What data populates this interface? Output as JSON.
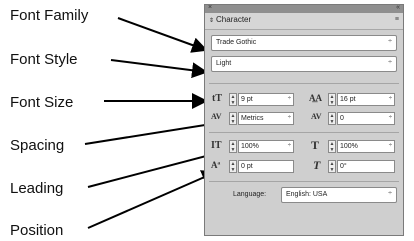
{
  "labels": {
    "font_family": "Font Family",
    "font_style": "Font Style",
    "font_size": "Font Size",
    "spacing": "Spacing",
    "leading": "Leading",
    "position": "Position"
  },
  "panel": {
    "close_glyph": "×",
    "collapse_glyph": "«",
    "tab_arrows": "⇕",
    "title": "Character",
    "menu_glyph": "≡",
    "font_family_value": "Trade Gothic",
    "font_style_value": "Light",
    "font_size_value": "9 pt",
    "leading_value": "16 pt",
    "kerning_value": "Metrics",
    "tracking_value": "0",
    "vertical_scale_value": "100%",
    "horizontal_scale_value": "100%",
    "baseline_shift_value": "0 pt",
    "skew_value": "0°",
    "language_label": "Language:",
    "language_value": "English: USA",
    "dropdown_arrow": "÷",
    "spin_up": "▲",
    "spin_down": "▼"
  },
  "icons": {
    "font_size": "tT",
    "leading": "A͟A",
    "kerning": "AV",
    "tracking": "AV",
    "vertical_scale": "IT",
    "horizontal_scale": "T",
    "baseline_shift": "Aª",
    "skew": "T"
  },
  "colors": {
    "panel_bg": "#cfcfcf",
    "title_bar": "#8f8f8f",
    "arrow": "#000000"
  }
}
